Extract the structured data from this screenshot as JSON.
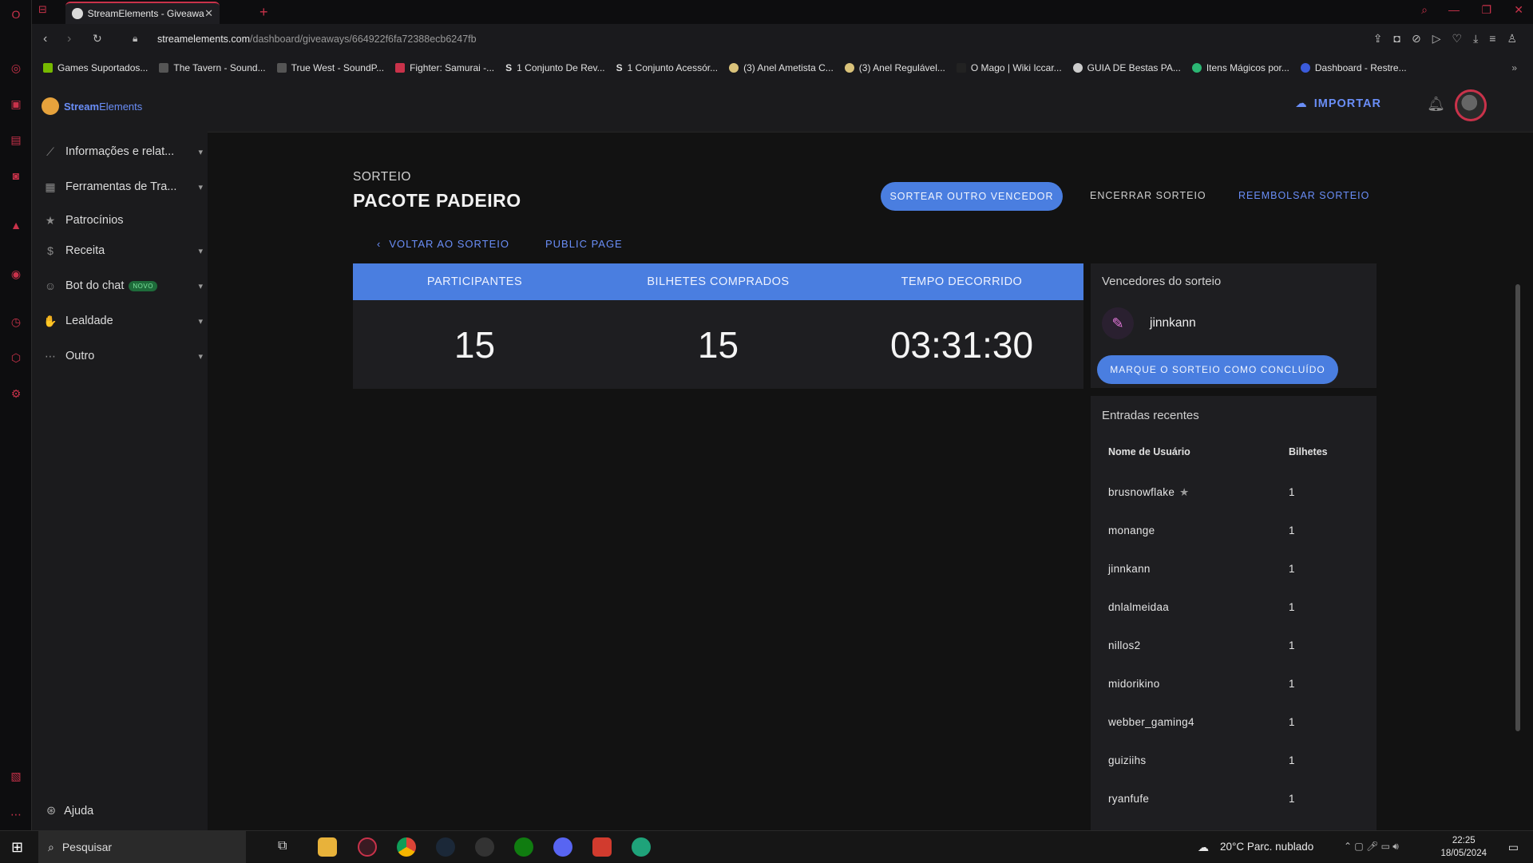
{
  "browser": {
    "tab_title": "StreamElements - Giveaway",
    "url_domain": "streamelements.com",
    "url_path": "/dashboard/giveaways/664922f6fa72388ecb6247fb",
    "bookmarks": [
      "Games Suportados...",
      "The Tavern - Sound...",
      "True West - SoundP...",
      "Fighter: Samurai -...",
      "1 Conjunto De Rev...",
      "1 Conjunto Acessór...",
      "(3) Anel Ametista C...",
      "(3) Anel Regulável...",
      "O Mago | Wiki Iccar...",
      "GUIA DE Bestas PA...",
      "Itens Mágicos por...",
      "Dashboard - Restre..."
    ]
  },
  "sidebar": {
    "logo_part1": "Stream",
    "logo_part2": "Elements",
    "items": [
      {
        "label": "Informações e relat...",
        "icon": "chart-line-icon"
      },
      {
        "label": "Ferramentas de Tra...",
        "icon": "layout-icon"
      },
      {
        "label": "Patrocínios",
        "icon": "star-icon"
      },
      {
        "label": "Receita",
        "icon": "dollar-icon"
      },
      {
        "label": "Bot do chat",
        "icon": "robot-icon",
        "badge": "NOVO"
      },
      {
        "label": "Lealdade",
        "icon": "hand-coins-icon"
      },
      {
        "label": "Outro",
        "icon": "more-horizontal-icon"
      }
    ],
    "help_label": "Ajuda"
  },
  "header": {
    "import_label": "IMPORTAR"
  },
  "giveaway": {
    "section_label": "SORTEIO",
    "title": "PACOTE PADEIRO",
    "btn_draw_other": "SORTEAR OUTRO VENCEDOR",
    "btn_end": "ENCERRAR SORTEIO",
    "btn_refund": "REEMBOLSAR SORTEIO",
    "back_label": "VOLTAR AO SORTEIO",
    "public_page_label": "PUBLIC PAGE",
    "stats": {
      "participants_label": "PARTICIPANTES",
      "participants_value": "15",
      "tickets_label": "BILHETES COMPRADOS",
      "tickets_value": "15",
      "elapsed_label": "TEMPO DECORRIDO",
      "elapsed_value": "03:31:30"
    },
    "winners": {
      "title": "Vencedores do sorteio",
      "winner_name": "jinnkann",
      "btn_complete": "MARQUE O SORTEIO COMO CONCLUÍDO"
    },
    "entries": {
      "title": "Entradas recentes",
      "col_user": "Nome de Usuário",
      "col_tickets": "Bilhetes",
      "rows": [
        {
          "user": "brusnowflake",
          "tickets": "1",
          "star": true
        },
        {
          "user": "monange",
          "tickets": "1"
        },
        {
          "user": "jinnkann",
          "tickets": "1"
        },
        {
          "user": "dnlalmeidaa",
          "tickets": "1"
        },
        {
          "user": "nillos2",
          "tickets": "1"
        },
        {
          "user": "midorikino",
          "tickets": "1"
        },
        {
          "user": "webber_gaming4",
          "tickets": "1"
        },
        {
          "user": "guiziihs",
          "tickets": "1"
        },
        {
          "user": "ryanfufe",
          "tickets": "1"
        }
      ]
    }
  },
  "taskbar": {
    "search_placeholder": "Pesquisar",
    "weather": "20°C  Parc. nublado",
    "time": "22:25",
    "date": "18/05/2024"
  },
  "colors": {
    "accent": "#4a7ee0",
    "link": "#6a8ef7",
    "opera_red": "#c9324a"
  }
}
